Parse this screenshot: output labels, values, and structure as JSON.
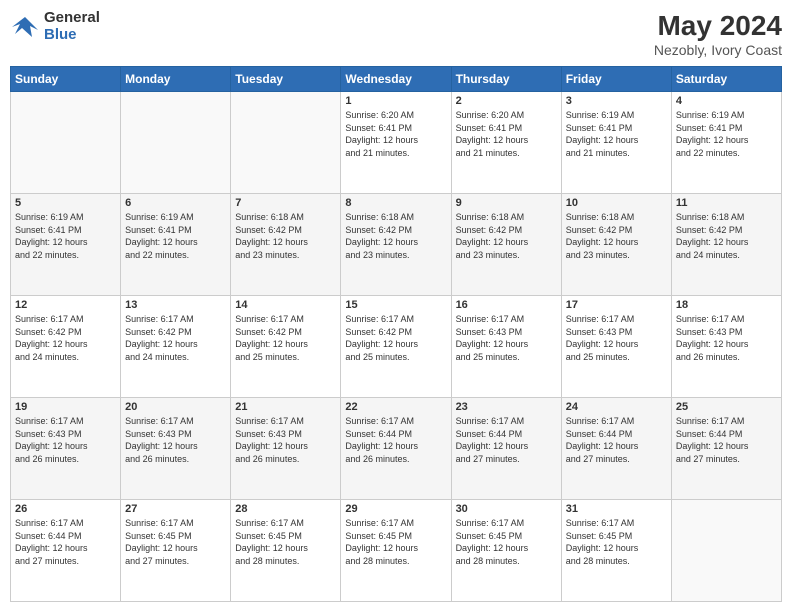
{
  "logo": {
    "line1": "General",
    "line2": "Blue"
  },
  "title": {
    "month_year": "May 2024",
    "location": "Nezobly, Ivory Coast"
  },
  "weekdays": [
    "Sunday",
    "Monday",
    "Tuesday",
    "Wednesday",
    "Thursday",
    "Friday",
    "Saturday"
  ],
  "weeks": [
    [
      {
        "day": "",
        "info": ""
      },
      {
        "day": "",
        "info": ""
      },
      {
        "day": "",
        "info": ""
      },
      {
        "day": "1",
        "info": "Sunrise: 6:20 AM\nSunset: 6:41 PM\nDaylight: 12 hours\nand 21 minutes."
      },
      {
        "day": "2",
        "info": "Sunrise: 6:20 AM\nSunset: 6:41 PM\nDaylight: 12 hours\nand 21 minutes."
      },
      {
        "day": "3",
        "info": "Sunrise: 6:19 AM\nSunset: 6:41 PM\nDaylight: 12 hours\nand 21 minutes."
      },
      {
        "day": "4",
        "info": "Sunrise: 6:19 AM\nSunset: 6:41 PM\nDaylight: 12 hours\nand 22 minutes."
      }
    ],
    [
      {
        "day": "5",
        "info": "Sunrise: 6:19 AM\nSunset: 6:41 PM\nDaylight: 12 hours\nand 22 minutes."
      },
      {
        "day": "6",
        "info": "Sunrise: 6:19 AM\nSunset: 6:41 PM\nDaylight: 12 hours\nand 22 minutes."
      },
      {
        "day": "7",
        "info": "Sunrise: 6:18 AM\nSunset: 6:42 PM\nDaylight: 12 hours\nand 23 minutes."
      },
      {
        "day": "8",
        "info": "Sunrise: 6:18 AM\nSunset: 6:42 PM\nDaylight: 12 hours\nand 23 minutes."
      },
      {
        "day": "9",
        "info": "Sunrise: 6:18 AM\nSunset: 6:42 PM\nDaylight: 12 hours\nand 23 minutes."
      },
      {
        "day": "10",
        "info": "Sunrise: 6:18 AM\nSunset: 6:42 PM\nDaylight: 12 hours\nand 23 minutes."
      },
      {
        "day": "11",
        "info": "Sunrise: 6:18 AM\nSunset: 6:42 PM\nDaylight: 12 hours\nand 24 minutes."
      }
    ],
    [
      {
        "day": "12",
        "info": "Sunrise: 6:17 AM\nSunset: 6:42 PM\nDaylight: 12 hours\nand 24 minutes."
      },
      {
        "day": "13",
        "info": "Sunrise: 6:17 AM\nSunset: 6:42 PM\nDaylight: 12 hours\nand 24 minutes."
      },
      {
        "day": "14",
        "info": "Sunrise: 6:17 AM\nSunset: 6:42 PM\nDaylight: 12 hours\nand 25 minutes."
      },
      {
        "day": "15",
        "info": "Sunrise: 6:17 AM\nSunset: 6:42 PM\nDaylight: 12 hours\nand 25 minutes."
      },
      {
        "day": "16",
        "info": "Sunrise: 6:17 AM\nSunset: 6:43 PM\nDaylight: 12 hours\nand 25 minutes."
      },
      {
        "day": "17",
        "info": "Sunrise: 6:17 AM\nSunset: 6:43 PM\nDaylight: 12 hours\nand 25 minutes."
      },
      {
        "day": "18",
        "info": "Sunrise: 6:17 AM\nSunset: 6:43 PM\nDaylight: 12 hours\nand 26 minutes."
      }
    ],
    [
      {
        "day": "19",
        "info": "Sunrise: 6:17 AM\nSunset: 6:43 PM\nDaylight: 12 hours\nand 26 minutes."
      },
      {
        "day": "20",
        "info": "Sunrise: 6:17 AM\nSunset: 6:43 PM\nDaylight: 12 hours\nand 26 minutes."
      },
      {
        "day": "21",
        "info": "Sunrise: 6:17 AM\nSunset: 6:43 PM\nDaylight: 12 hours\nand 26 minutes."
      },
      {
        "day": "22",
        "info": "Sunrise: 6:17 AM\nSunset: 6:44 PM\nDaylight: 12 hours\nand 26 minutes."
      },
      {
        "day": "23",
        "info": "Sunrise: 6:17 AM\nSunset: 6:44 PM\nDaylight: 12 hours\nand 27 minutes."
      },
      {
        "day": "24",
        "info": "Sunrise: 6:17 AM\nSunset: 6:44 PM\nDaylight: 12 hours\nand 27 minutes."
      },
      {
        "day": "25",
        "info": "Sunrise: 6:17 AM\nSunset: 6:44 PM\nDaylight: 12 hours\nand 27 minutes."
      }
    ],
    [
      {
        "day": "26",
        "info": "Sunrise: 6:17 AM\nSunset: 6:44 PM\nDaylight: 12 hours\nand 27 minutes."
      },
      {
        "day": "27",
        "info": "Sunrise: 6:17 AM\nSunset: 6:45 PM\nDaylight: 12 hours\nand 27 minutes."
      },
      {
        "day": "28",
        "info": "Sunrise: 6:17 AM\nSunset: 6:45 PM\nDaylight: 12 hours\nand 28 minutes."
      },
      {
        "day": "29",
        "info": "Sunrise: 6:17 AM\nSunset: 6:45 PM\nDaylight: 12 hours\nand 28 minutes."
      },
      {
        "day": "30",
        "info": "Sunrise: 6:17 AM\nSunset: 6:45 PM\nDaylight: 12 hours\nand 28 minutes."
      },
      {
        "day": "31",
        "info": "Sunrise: 6:17 AM\nSunset: 6:45 PM\nDaylight: 12 hours\nand 28 minutes."
      },
      {
        "day": "",
        "info": ""
      }
    ]
  ]
}
